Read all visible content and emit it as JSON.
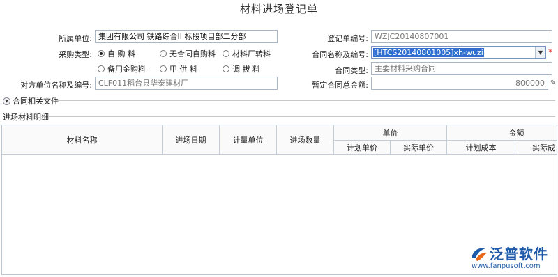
{
  "page": {
    "title": "材料进场登记单"
  },
  "form": {
    "unit_label": "所属单位:",
    "unit_value": "      集团有限公司     铁路综合II 标段项目部二分部",
    "purchase_type_label": "采购类型:",
    "purchase_options": [
      {
        "label": "自 购 料",
        "selected": true
      },
      {
        "label": "无合同自购料",
        "selected": false
      },
      {
        "label": "材料厂转料",
        "selected": false
      },
      {
        "label": "备用金购料",
        "selected": false
      },
      {
        "label": "甲 供 料",
        "selected": false
      },
      {
        "label": "调 拔 料",
        "selected": false
      }
    ],
    "partner_label": "对方单位名称及编号:",
    "partner_value": "CLF011稻台县华泰建材厂",
    "reg_no_label": "登记单编号:",
    "reg_no_value": "WZJC20140807001",
    "contract_label": "合同名称及编号:",
    "contract_value": "[HTCS20140801005]xh-wuzi",
    "contract_type_label": "合同类型:",
    "contract_type_value": "主要材料采购合同",
    "amount_label": "暂定合同总金额:",
    "amount_value": "800000",
    "required_mark": "*"
  },
  "sections": {
    "contract_files": "合同相关文件",
    "detail": "进场材料明细"
  },
  "table": {
    "col_name": "材料名称",
    "col_date": "进场日期",
    "col_unit": "计量单位",
    "col_qty": "进场数量",
    "group_price": "单价",
    "col_plan_price": "计划单价",
    "col_actual_price": "实际单价",
    "group_amount": "金额",
    "col_plan_cost": "计划成本",
    "col_actual_cost": "实际成"
  },
  "logo": {
    "name": "泛普软件",
    "url": "www.fanpusoft.com"
  },
  "colors": {
    "selection": "#2f6fd0",
    "brand": "#1e5aa8",
    "required": "#e02020"
  }
}
